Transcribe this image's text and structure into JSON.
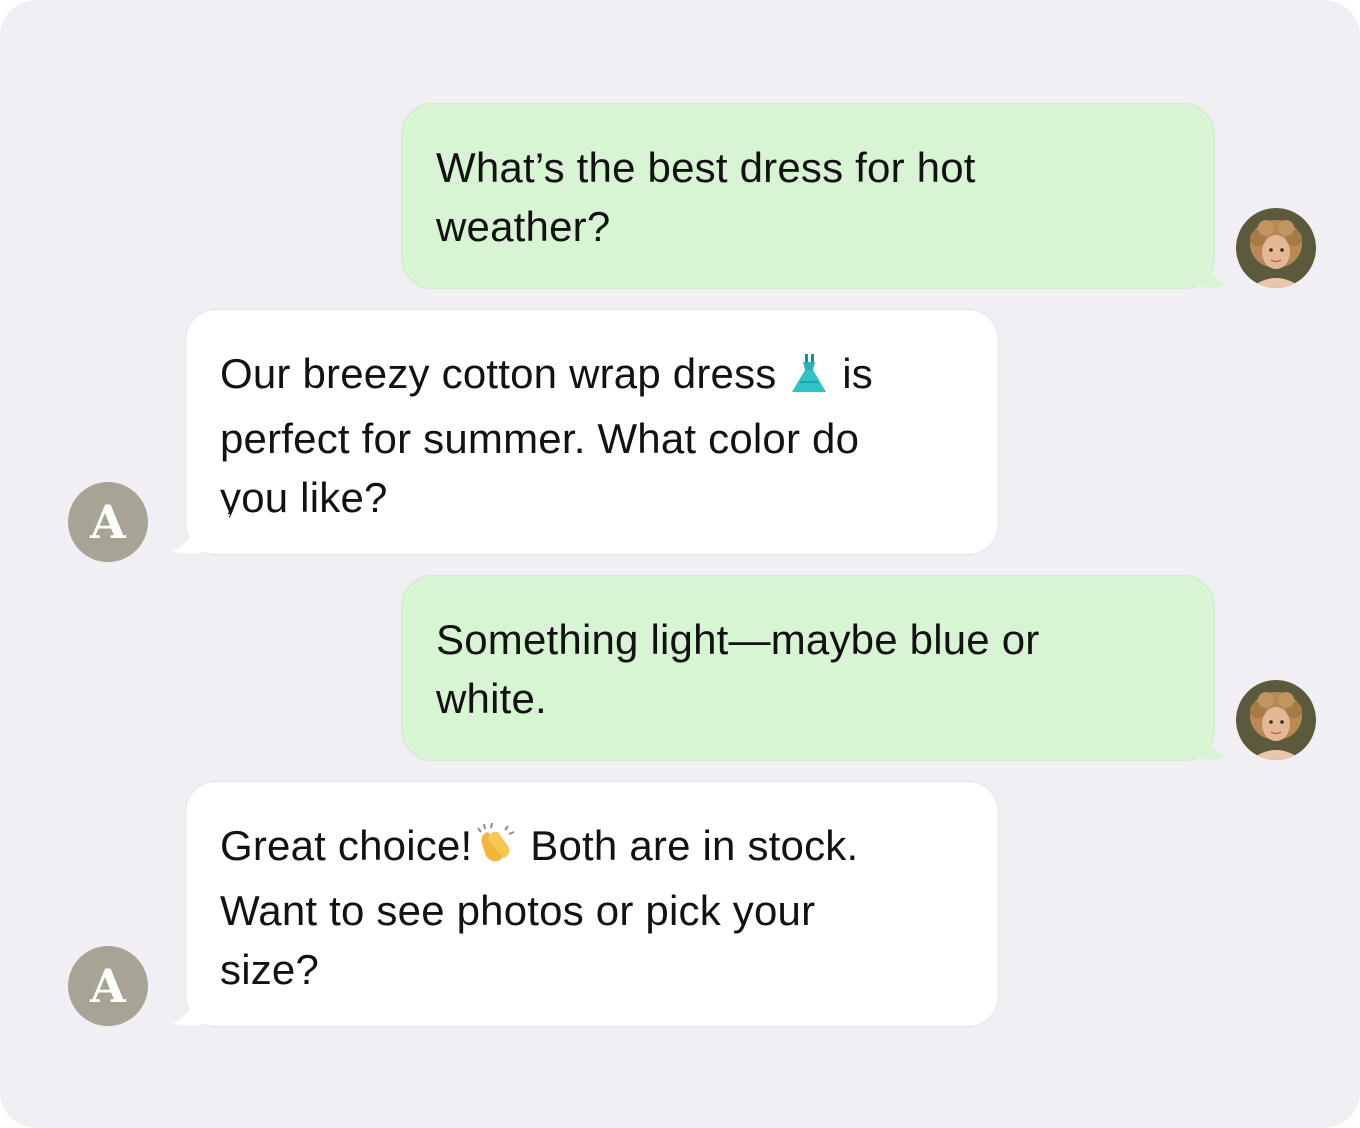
{
  "assistant": {
    "avatar_letter": "A"
  },
  "messages": [
    {
      "role": "user",
      "text": "What’s the best dress for hot weather?"
    },
    {
      "role": "assistant",
      "text_before_emoji": "Our breezy cotton wrap dress ",
      "emoji": "dress-emoji",
      "text_after_emoji_line1": " is",
      "line2": "perfect for summer. What color do",
      "line3": "you like?"
    },
    {
      "role": "user",
      "text": "Something light—maybe blue or white."
    },
    {
      "role": "assistant",
      "text_before_emoji": "Great choice!",
      "emoji": "clapping-hands-emoji",
      "text_after_emoji_line1": " Both are in stock.",
      "line2": "Want to see photos or pick your",
      "line3": "size?"
    }
  ],
  "colors": {
    "background": "#f1eff3",
    "user_bubble": "#d8f5d3",
    "assistant_bubble": "#ffffff",
    "assistant_avatar": "#a7a395"
  }
}
